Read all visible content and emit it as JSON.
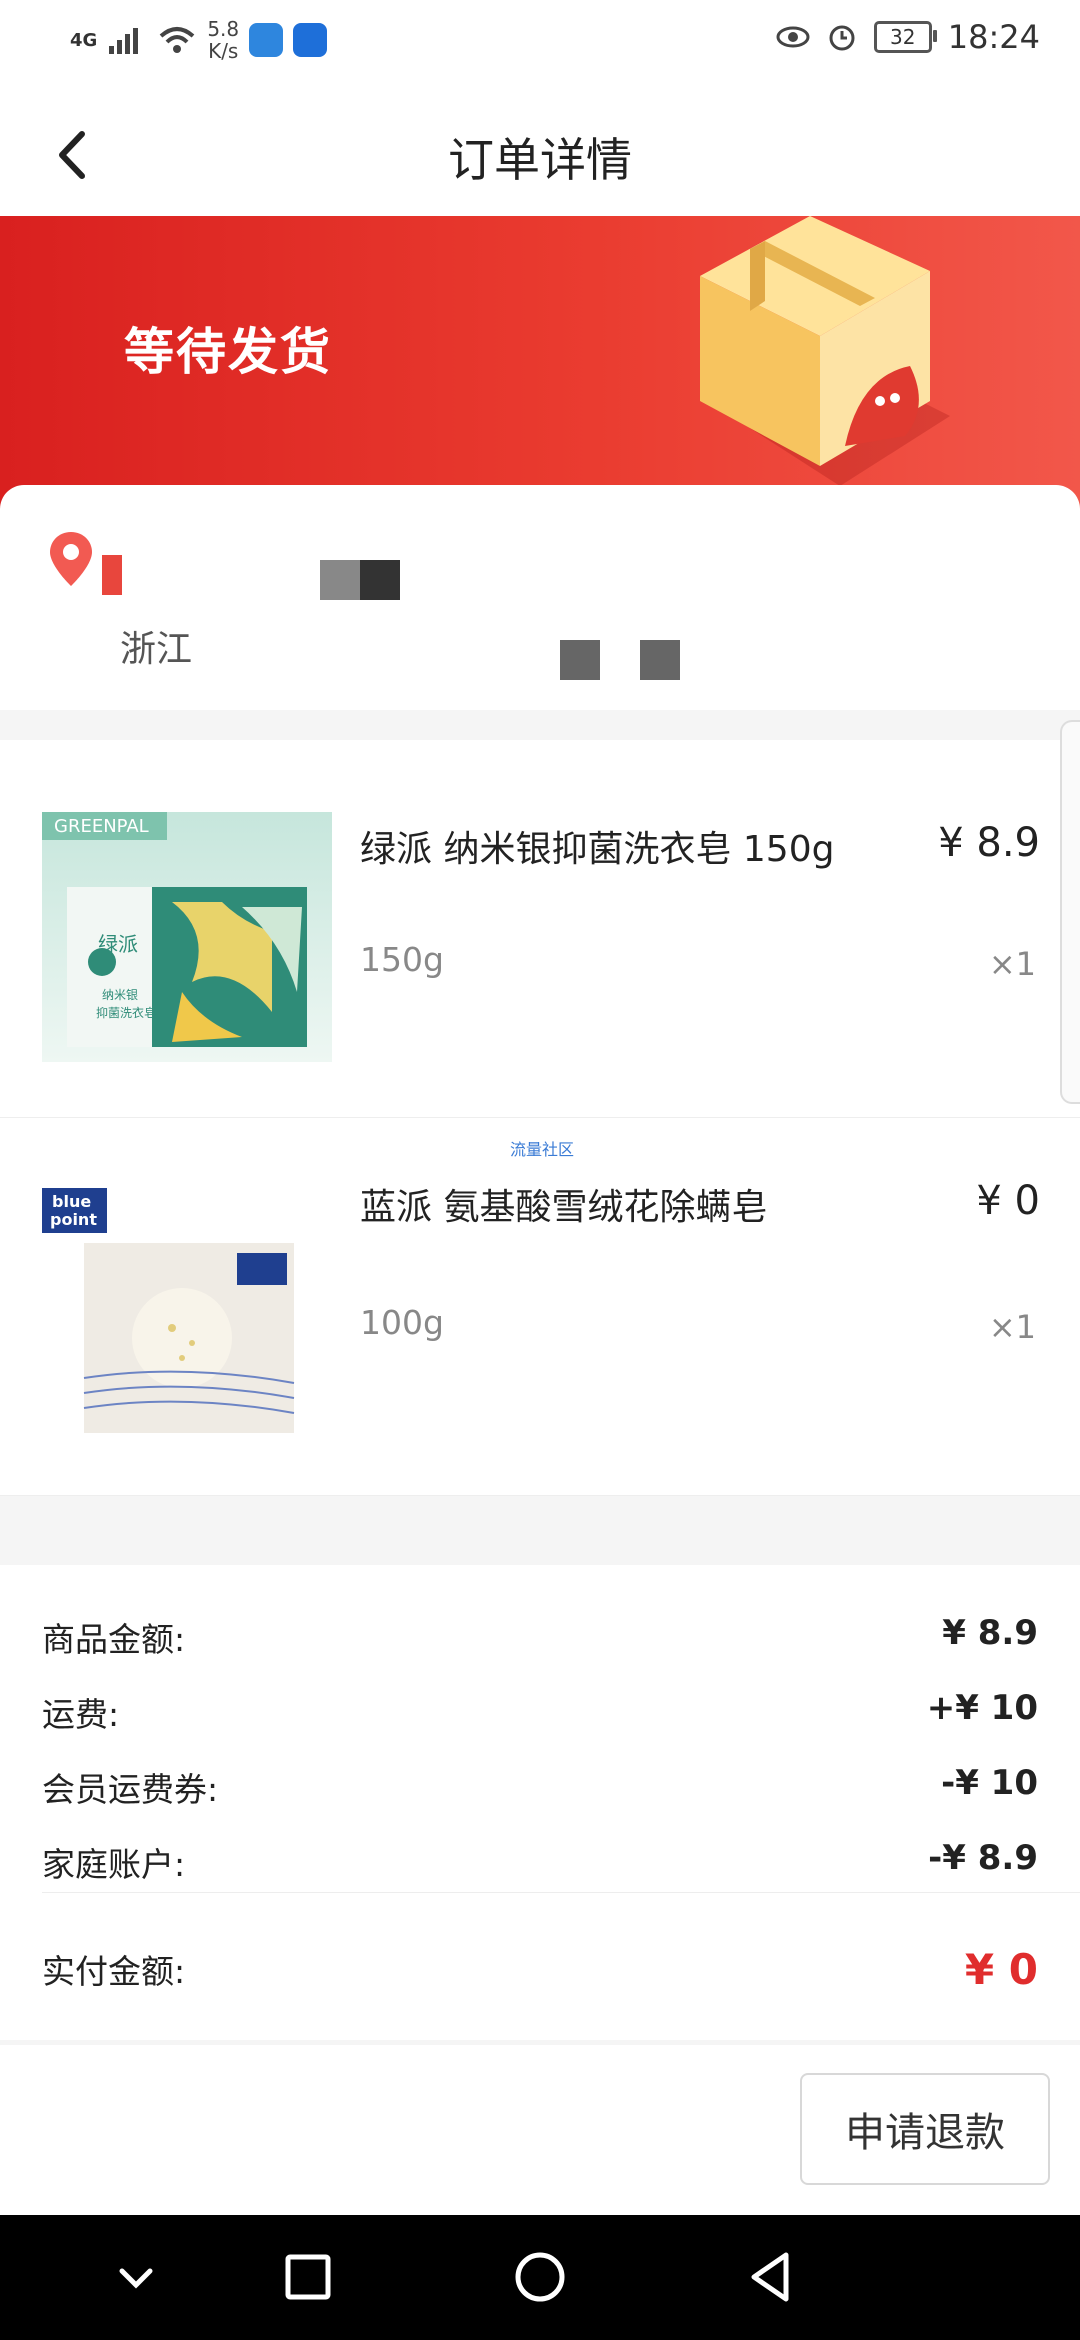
{
  "status_bar": {
    "network": "4G",
    "net_speed_value": "5.8",
    "net_speed_unit": "K/s",
    "battery": "32",
    "time": "18:24"
  },
  "header": {
    "title": "订单详情"
  },
  "banner": {
    "status": "等待发货"
  },
  "address": {
    "province": "浙江"
  },
  "products": [
    {
      "name": "绿派 纳米银抑菌洗衣皂 150g",
      "price": "¥ 8.9",
      "spec": "150g",
      "qty": "×1",
      "image_brand": "GREENPAL",
      "image_brand_cn": "绿派",
      "image_caption_line1": "纳米银",
      "image_caption_line2": "抑菌洗衣皂"
    },
    {
      "name": "蓝派 氨基酸雪绒花除螨皂",
      "price": "¥ 0",
      "spec": "100g",
      "qty": "×1",
      "image_brand_line1": "blue",
      "image_brand_line2": "point",
      "tag": "流量社区"
    }
  ],
  "summary": {
    "rows": [
      {
        "label": "商品金额:",
        "value": "¥ 8.9"
      },
      {
        "label": "运费:",
        "value": "+¥ 10"
      },
      {
        "label": "会员运费券:",
        "value": "-¥ 10"
      },
      {
        "label": "家庭账户:",
        "value": "-¥ 8.9"
      }
    ],
    "total_label": "实付金额:",
    "total_value": "¥ 0"
  },
  "footer": {
    "refund_label": "申请退款"
  },
  "colors": {
    "accent_red": "#e02d2d",
    "banner_start": "#d9201f",
    "banner_end": "#f2574a"
  }
}
